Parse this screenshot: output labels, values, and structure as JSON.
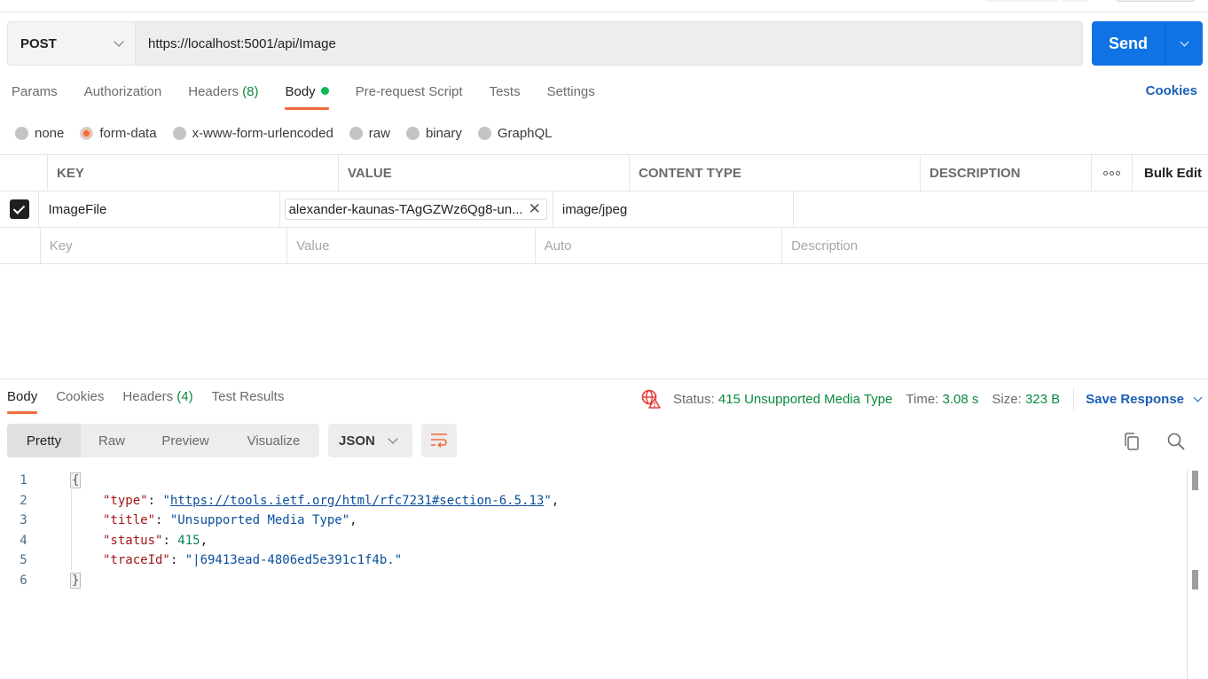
{
  "request": {
    "method": "POST",
    "url": "https://localhost:5001/api/Image",
    "send_label": "Send"
  },
  "request_tabs": [
    {
      "label": "Params",
      "count": ""
    },
    {
      "label": "Authorization",
      "count": ""
    },
    {
      "label": "Headers",
      "count": "(8)"
    },
    {
      "label": "Body",
      "count": ""
    },
    {
      "label": "Pre-request Script",
      "count": ""
    },
    {
      "label": "Tests",
      "count": ""
    },
    {
      "label": "Settings",
      "count": ""
    }
  ],
  "active_request_tab": "Body",
  "cookies_link": "Cookies",
  "body_types": [
    {
      "label": "none",
      "selected": false
    },
    {
      "label": "form-data",
      "selected": true
    },
    {
      "label": "x-www-form-urlencoded",
      "selected": false
    },
    {
      "label": "raw",
      "selected": false
    },
    {
      "label": "binary",
      "selected": false
    },
    {
      "label": "GraphQL",
      "selected": false
    }
  ],
  "params_table": {
    "headers": {
      "key": "KEY",
      "value": "VALUE",
      "content_type": "CONTENT TYPE",
      "description": "DESCRIPTION",
      "bulk_edit": "Bulk Edit"
    },
    "rows": [
      {
        "checked": true,
        "key": "ImageFile",
        "value": "alexander-kaunas-TAgGZWz6Qg8-un...",
        "content_type": "image/jpeg",
        "description": ""
      }
    ],
    "placeholders": {
      "key": "Key",
      "value": "Value",
      "content_type": "Auto",
      "description": "Description"
    }
  },
  "response": {
    "tabs": [
      {
        "label": "Body",
        "count": ""
      },
      {
        "label": "Cookies",
        "count": ""
      },
      {
        "label": "Headers",
        "count": "(4)"
      },
      {
        "label": "Test Results",
        "count": ""
      }
    ],
    "active_tab": "Body",
    "status_label": "Status:",
    "status_value": "415 Unsupported Media Type",
    "time_label": "Time:",
    "time_value": "3.08 s",
    "size_label": "Size:",
    "size_value": "323 B",
    "save_response": "Save Response",
    "view_modes": [
      "Pretty",
      "Raw",
      "Preview",
      "Visualize"
    ],
    "active_view_mode": "Pretty",
    "format": "JSON",
    "body_lines": {
      "l1": {
        "num": "1",
        "open": "{"
      },
      "l2": {
        "num": "2",
        "key": "\"type\"",
        "value": "https://tools.ietf.org/html/rfc7231#section-6.5.13"
      },
      "l3": {
        "num": "3",
        "key": "\"title\"",
        "value": "\"Unsupported Media Type\""
      },
      "l4": {
        "num": "4",
        "key": "\"status\"",
        "value": "415"
      },
      "l5": {
        "num": "5",
        "key": "\"traceId\"",
        "value": "\"|69413ead-4806ed5e391c1f4b.\""
      },
      "l6": {
        "num": "6",
        "close": "}"
      }
    }
  },
  "colors": {
    "send_button": "#0f72e5",
    "active_tab_underline": "#f26b3a",
    "status_green": "#0b8a3e",
    "link_blue": "#1a5fb4",
    "error_icon": "#e53935"
  }
}
